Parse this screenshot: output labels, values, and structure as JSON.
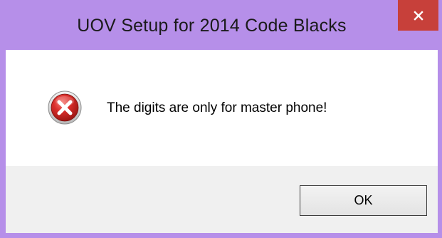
{
  "window": {
    "title": "UOV Setup for 2014 Code Blacks",
    "close_icon": "close-icon"
  },
  "dialog": {
    "icon": "error-icon",
    "message": "The digits are only for master phone!",
    "ok_label": "OK"
  },
  "colors": {
    "titlebar": "#b68fe9",
    "close_button": "#c7403a",
    "footer": "#f0f0f0",
    "error_red": "#d2272b"
  }
}
